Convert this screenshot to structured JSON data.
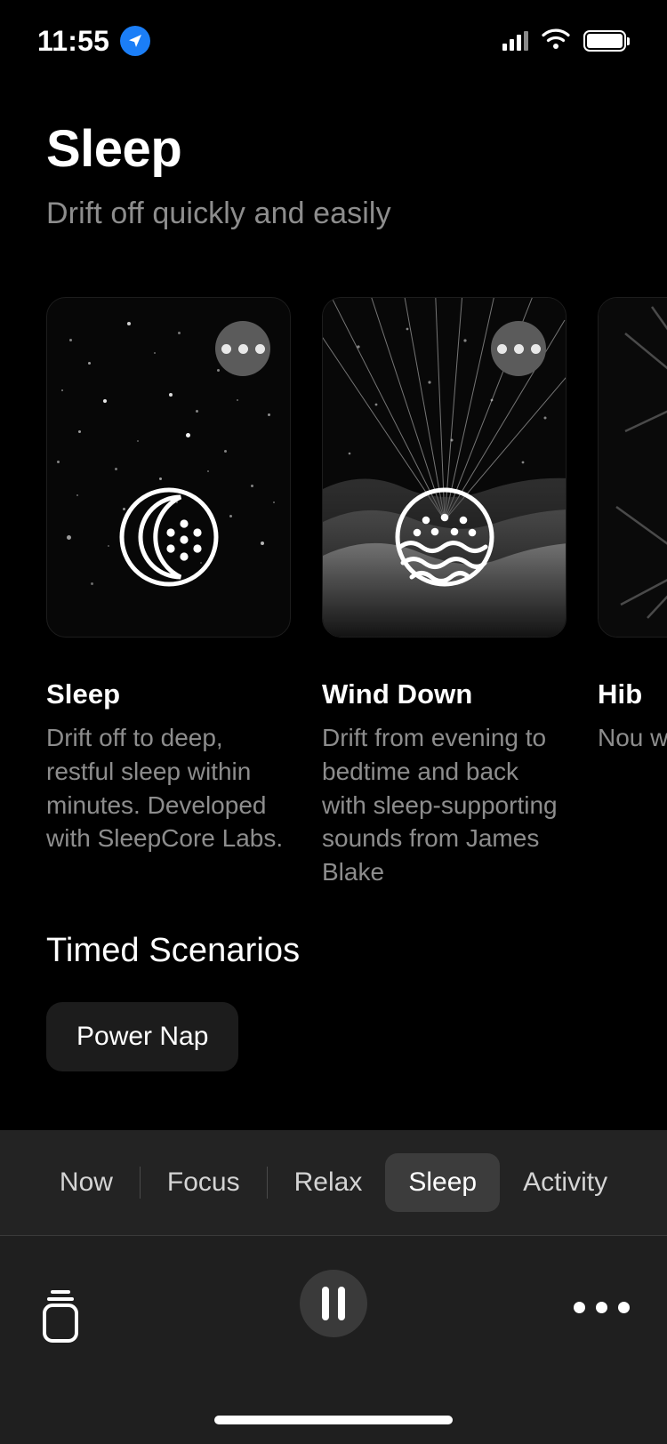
{
  "status_bar": {
    "time": "11:55",
    "location_icon": "location-arrow-icon",
    "cellular_icon": "cellular-signal-icon",
    "wifi_icon": "wifi-icon",
    "battery_icon": "battery-icon",
    "location_accent": "#1b7ef7"
  },
  "header": {
    "title": "Sleep",
    "subtitle": "Drift off quickly and easily"
  },
  "cards": [
    {
      "title": "Sleep",
      "description": "Drift off to deep, restful sleep within minutes. Developed with SleepCore Labs.",
      "art": "starfield-night-sky",
      "icon": "crescent-moon-dots-icon",
      "more_icon": "more-options-icon"
    },
    {
      "title": "Wind Down",
      "description": "Drift from evening to bedtime and back with sleep-supporting sounds from James Blake",
      "art": "sunrays-over-hills",
      "icon": "dots-waves-circle-icon",
      "more_icon": "more-options-icon"
    },
    {
      "title": "Hib",
      "description": "Nou with sou sea",
      "art": "angular-rays",
      "icon": "partial-icon",
      "more_icon": "more-options-icon"
    }
  ],
  "timed_scenarios": {
    "heading": "Timed Scenarios",
    "chips": [
      {
        "label": "Power Nap"
      }
    ]
  },
  "tabs": [
    {
      "label": "Now",
      "active": false
    },
    {
      "label": "Focus",
      "active": false
    },
    {
      "label": "Relax",
      "active": false
    },
    {
      "label": "Sleep",
      "active": true
    },
    {
      "label": "Activity",
      "active": false
    }
  ],
  "player": {
    "library_icon": "stacked-cards-icon",
    "playpause_icon": "pause-icon",
    "more_icon": "more-options-icon"
  },
  "colors": {
    "background": "#000000",
    "tabbar_background": "#232323",
    "playerbar_background": "#1f1f1f",
    "active_tab": "#3c3c3c",
    "chip_background": "#1c1c1c",
    "muted_text": "#8d8d8d"
  }
}
